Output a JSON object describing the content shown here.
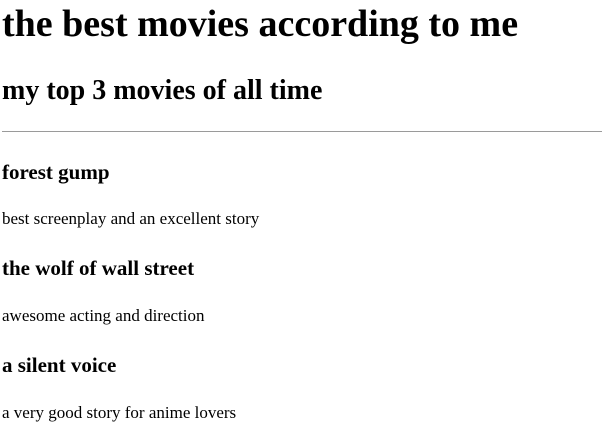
{
  "page": {
    "title": "the best movies according to me",
    "subtitle": "my top 3 movies of all time"
  },
  "movies": [
    {
      "title": "forest gump",
      "description": "best screenplay and an excellent story"
    },
    {
      "title": "the wolf of wall street",
      "description": "awesome acting and direction"
    },
    {
      "title": "a silent voice",
      "description": "a very good story for anime lovers"
    }
  ]
}
